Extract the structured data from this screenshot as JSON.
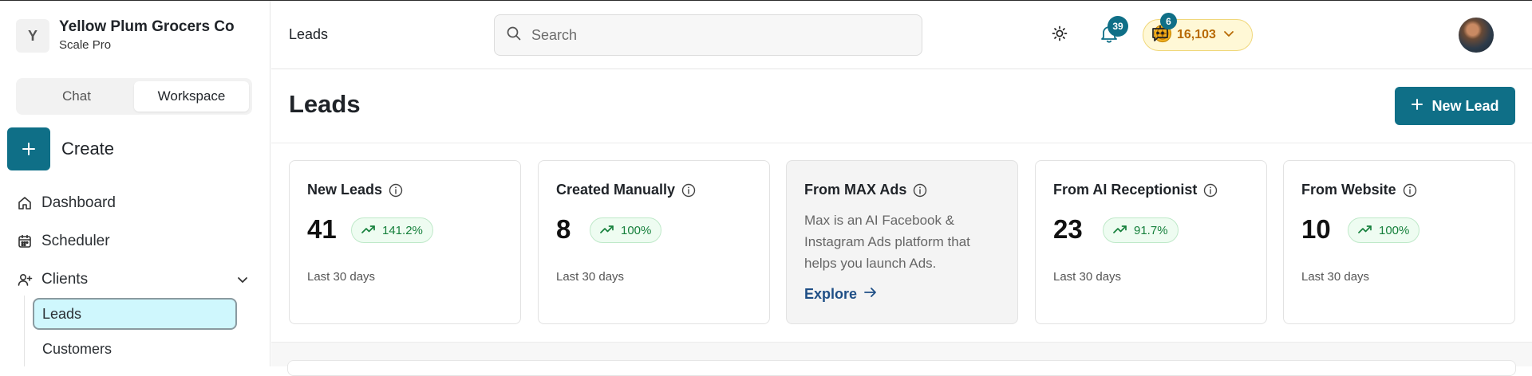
{
  "org": {
    "initial": "Y",
    "name": "Yellow Plum Grocers Co",
    "plan": "Scale Pro"
  },
  "mode_switch": {
    "chat": "Chat",
    "workspace": "Workspace",
    "active": "Workspace"
  },
  "create": {
    "label": "Create"
  },
  "nav": {
    "dashboard": "Dashboard",
    "scheduler": "Scheduler",
    "clients": "Clients",
    "clients_children": {
      "leads": "Leads",
      "customers": "Customers"
    }
  },
  "topbar": {
    "breadcrumb": "Leads",
    "search_placeholder": "Search",
    "credits": "16,103",
    "notifications_count": "39",
    "messages_count": "6"
  },
  "page": {
    "title": "Leads",
    "new_button": "New Lead"
  },
  "cards": [
    {
      "title": "New Leads",
      "value": "41",
      "change": "141.2%",
      "period": "Last 30 days"
    },
    {
      "title": "Created Manually",
      "value": "8",
      "change": "100%",
      "period": "Last 30 days"
    },
    {
      "title": "From MAX Ads",
      "description": "Max is an AI Facebook & Instagram Ads platform that helps you launch Ads.",
      "link": "Explore"
    },
    {
      "title": "From AI Receptionist",
      "value": "23",
      "change": "91.7%",
      "period": "Last 30 days"
    },
    {
      "title": "From Website",
      "value": "10",
      "change": "100%",
      "period": "Last 30 days"
    }
  ],
  "colors": {
    "brand": "#0f6f87",
    "active_nav_bg": "#cff7fd",
    "positive": "#16803c",
    "credits": "#b86a05"
  },
  "icons": [
    "search-icon",
    "coin-icon",
    "chevron-down-icon",
    "sun-icon",
    "bell-icon",
    "chat-bot-icon",
    "home-icon",
    "calendar-icon",
    "user-plus-icon",
    "info-icon",
    "trend-up-icon",
    "plus-icon",
    "arrow-right-icon"
  ]
}
